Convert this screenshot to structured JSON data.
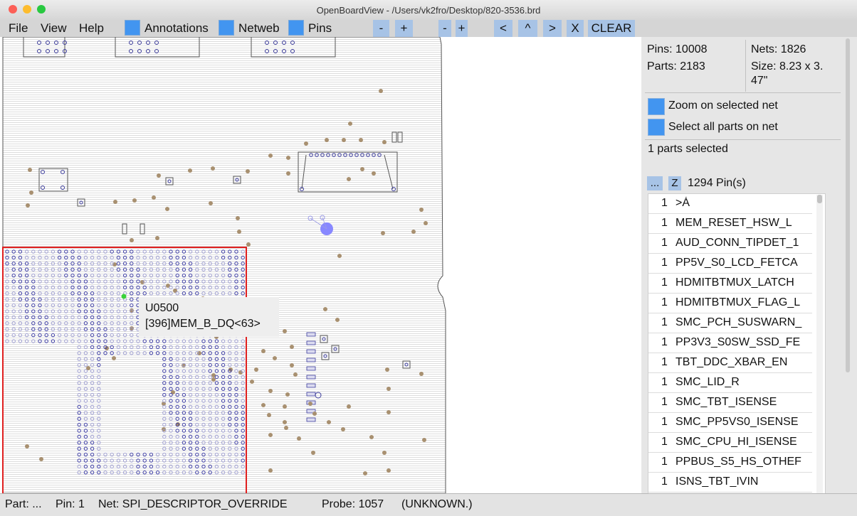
{
  "window": {
    "title": "OpenBoardView - /Users/vk2fro/Desktop/820-3536.brd",
    "traffic_colors": [
      "#fc5f57",
      "#fdbc2e",
      "#28c840"
    ]
  },
  "menu": {
    "file": "File",
    "view": "View",
    "help": "Help"
  },
  "toolbar": {
    "annotations_label": "Annotations",
    "netweb_label": "Netweb",
    "pins_label": "Pins",
    "zoom_out_1": "-",
    "zoom_in_1": "+",
    "zoom_out_2": "-",
    "zoom_in_2": "+",
    "nav_left": "<",
    "nav_up": "^",
    "nav_right": ">",
    "close": "X",
    "clear": "CLEAR"
  },
  "info": {
    "pins": "Pins: 10008",
    "parts": "Parts: 2183",
    "nets": "Nets: 1826",
    "size_line1": "Size: 8.23 x 3.",
    "size_line2": "47\""
  },
  "options": {
    "zoom_selected_net": "Zoom on selected net",
    "select_all_parts": "Select all parts on net"
  },
  "selection": {
    "parts_selected": "1 parts selected",
    "more_button": "...",
    "z_button": "Z",
    "pin_count": "1294 Pin(s)"
  },
  "pins": [
    {
      "num": "1",
      "name": ">Á"
    },
    {
      "num": "1",
      "name": "MEM_RESET_HSW_L"
    },
    {
      "num": "1",
      "name": "AUD_CONN_TIPDET_1"
    },
    {
      "num": "1",
      "name": "PP5V_S0_LCD_FETCA"
    },
    {
      "num": "1",
      "name": "HDMITBTMUX_LATCH"
    },
    {
      "num": "1",
      "name": "HDMITBTMUX_FLAG_L"
    },
    {
      "num": "1",
      "name": "SMC_PCH_SUSWARN_"
    },
    {
      "num": "1",
      "name": "PP3V3_S0SW_SSD_FE"
    },
    {
      "num": "1",
      "name": "TBT_DDC_XBAR_EN"
    },
    {
      "num": "1",
      "name": "SMC_LID_R"
    },
    {
      "num": "1",
      "name": "SMC_TBT_ISENSE"
    },
    {
      "num": "1",
      "name": "SMC_PP5VS0_ISENSE"
    },
    {
      "num": "1",
      "name": "SMC_CPU_HI_ISENSE"
    },
    {
      "num": "1",
      "name": "PPBUS_S5_HS_OTHEF"
    },
    {
      "num": "1",
      "name": "ISNS_TBT_IVIN"
    }
  ],
  "tooltip": {
    "part": "U0500",
    "net": "[396]MEM_B_DQ<63>"
  },
  "status": {
    "part": "Part: ...",
    "pin": "Pin: 1",
    "net": "Net: SPI_DESCRIPTOR_OVERRIDE",
    "probe": "Probe: 1057",
    "unknown": "(UNKNOWN.)"
  },
  "colors": {
    "accent": "#4295f0",
    "button": "#a7c3e6",
    "selection_outline": "#e02020",
    "pad": "#a89070",
    "pin": "#3a3a9a",
    "highlight_pin": "#3ad23a",
    "probe_pin": "#8888ff"
  }
}
